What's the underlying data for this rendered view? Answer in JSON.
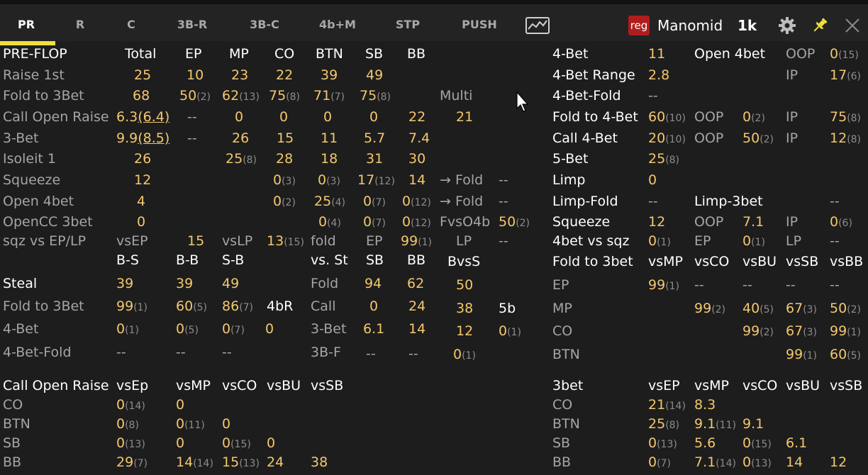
{
  "tabs": [
    "PR",
    "R",
    "C",
    "3B-R",
    "3B-C",
    "4b+M",
    "STP",
    "PUSH"
  ],
  "active_tab": "PR",
  "colors": {
    "accent": "#f2df3c",
    "value": "#f3c76e",
    "badge": "#b01d1d"
  },
  "icons": [
    "chart-icon",
    "gear-icon",
    "pin-icon",
    "close-icon"
  ],
  "player": {
    "badge": "reg",
    "name": "Manomid",
    "hands": "1k"
  },
  "cells": [
    [
      "PRE-FLOP",
      "h"
    ],
    [
      "Total",
      "h"
    ],
    [
      "EP",
      "h"
    ],
    [
      "MP",
      "h"
    ],
    [
      "CO",
      "h"
    ],
    [
      "BTN",
      "h"
    ],
    [
      "SB",
      "h"
    ],
    [
      "BB",
      "h"
    ],
    [
      "Raise 1st",
      "l"
    ],
    [
      "25",
      "v"
    ],
    [
      "10",
      "v"
    ],
    [
      "23",
      "v"
    ],
    [
      "22",
      "v"
    ],
    [
      "39",
      "v"
    ],
    [
      "49",
      "v"
    ],
    [
      "Fold to 3Bet",
      "l"
    ],
    [
      "68",
      "v"
    ],
    [
      "50",
      "v",
      "(2)"
    ],
    [
      "62",
      "v",
      "(13)"
    ],
    [
      "75",
      "v",
      "(8)"
    ],
    [
      "71",
      "v",
      "(7)"
    ],
    [
      "75",
      "v",
      "(8)"
    ],
    [
      "Multi",
      "l"
    ],
    [
      "Call Open Raise",
      "l"
    ],
    [
      "6.3",
      "v",
      "",
      "(6.4)"
    ],
    [
      "--",
      "g"
    ],
    [
      "0",
      "v"
    ],
    [
      "0",
      "v"
    ],
    [
      "0",
      "v"
    ],
    [
      "0",
      "v"
    ],
    [
      "22",
      "v"
    ],
    [
      "21",
      "v"
    ],
    [
      "3-Bet",
      "l"
    ],
    [
      "9.9",
      "v",
      "",
      "(8.5)"
    ],
    [
      "--",
      "g"
    ],
    [
      "26",
      "v"
    ],
    [
      "15",
      "v"
    ],
    [
      "11",
      "v"
    ],
    [
      "5.7",
      "v"
    ],
    [
      "7.4",
      "v"
    ],
    [
      "Isoleit 1",
      "l"
    ],
    [
      "26",
      "v"
    ],
    [
      "25",
      "v",
      "(8)"
    ],
    [
      "28",
      "v"
    ],
    [
      "18",
      "v"
    ],
    [
      "31",
      "v"
    ],
    [
      "30",
      "v"
    ],
    [
      "Squeeze",
      "l"
    ],
    [
      "12",
      "v"
    ],
    [
      "0",
      "v",
      "(3)"
    ],
    [
      "0",
      "v",
      "(3)"
    ],
    [
      "17",
      "v",
      "(12)"
    ],
    [
      "14",
      "v"
    ],
    [
      "→ Fold",
      "l"
    ],
    [
      "--",
      "g"
    ],
    [
      "Open 4bet",
      "l"
    ],
    [
      "4",
      "v"
    ],
    [
      "0",
      "v",
      "(2)"
    ],
    [
      "25",
      "v",
      "(4)"
    ],
    [
      "0",
      "v",
      "(7)"
    ],
    [
      "0",
      "v",
      "(12)"
    ],
    [
      "→ Fold",
      "l"
    ],
    [
      "--",
      "g"
    ],
    [
      "OpenCC 3bet",
      "l"
    ],
    [
      "0",
      "v"
    ],
    [
      "0",
      "v",
      "(4)"
    ],
    [
      "0",
      "v",
      "(7)"
    ],
    [
      "0",
      "v",
      "(12)"
    ],
    [
      "FvsO4b",
      "l"
    ],
    [
      "50",
      "v",
      "(2)"
    ],
    [
      "sqz vs EP/LP",
      "l"
    ],
    [
      "vsEP",
      "l"
    ],
    [
      "15",
      "v"
    ],
    [
      "vsLP",
      "l"
    ],
    [
      "13",
      "v",
      "(15)"
    ],
    [
      "fold",
      "l"
    ],
    [
      "EP",
      "l"
    ],
    [
      "99",
      "v",
      "(1)"
    ],
    [
      "LP",
      "l"
    ],
    [
      "--",
      "g"
    ],
    [
      "B-S",
      "h"
    ],
    [
      "B-B",
      "h"
    ],
    [
      "S-B",
      "h"
    ],
    [
      "vs. St",
      "h"
    ],
    [
      "SB",
      "h"
    ],
    [
      "BB",
      "h"
    ],
    [
      "BvsS",
      "h"
    ],
    [
      "Steal",
      "h"
    ],
    [
      "39",
      "v"
    ],
    [
      "39",
      "v"
    ],
    [
      "49",
      "v"
    ],
    [
      "Fold",
      "l"
    ],
    [
      "94",
      "v"
    ],
    [
      "62",
      "v"
    ],
    [
      "50",
      "v"
    ],
    [
      "Fold to 3Bet",
      "l"
    ],
    [
      "99",
      "v",
      "(1)"
    ],
    [
      "60",
      "v",
      "(5)"
    ],
    [
      "86",
      "v",
      "(7)"
    ],
    [
      "4bR",
      "h"
    ],
    [
      "Call",
      "l"
    ],
    [
      "0",
      "v"
    ],
    [
      "24",
      "v"
    ],
    [
      "38",
      "v"
    ],
    [
      "5b",
      "h"
    ],
    [
      "4-Bet",
      "l"
    ],
    [
      "0",
      "v",
      "(1)"
    ],
    [
      "0",
      "v",
      "(5)"
    ],
    [
      "0",
      "v",
      "(7)"
    ],
    [
      "0",
      "v"
    ],
    [
      "3-Bet",
      "l"
    ],
    [
      "6.1",
      "v"
    ],
    [
      "14",
      "v"
    ],
    [
      "12",
      "v"
    ],
    [
      "0",
      "v",
      "(1)"
    ],
    [
      "4-Bet-Fold",
      "l"
    ],
    [
      "--",
      "g"
    ],
    [
      "--",
      "g"
    ],
    [
      "--",
      "g"
    ],
    [
      "3B-F",
      "l"
    ],
    [
      "--",
      "g"
    ],
    [
      "--",
      "g"
    ],
    [
      "0",
      "v",
      "(1)"
    ],
    [
      "Call Open Raise",
      "h"
    ],
    [
      "vsEp",
      "h"
    ],
    [
      "vsMP",
      "h"
    ],
    [
      "vsCO",
      "h"
    ],
    [
      "vsBU",
      "h"
    ],
    [
      "vsSB",
      "h"
    ],
    [
      "CO",
      "l"
    ],
    [
      "0",
      "v",
      "(14)"
    ],
    [
      "0",
      "v"
    ],
    [
      "BTN",
      "l"
    ],
    [
      "0",
      "v",
      "(8)"
    ],
    [
      "0",
      "v",
      "(11)"
    ],
    [
      "0",
      "v"
    ],
    [
      "SB",
      "l"
    ],
    [
      "0",
      "v",
      "(13)"
    ],
    [
      "0",
      "v"
    ],
    [
      "0",
      "v",
      "(15)"
    ],
    [
      "0",
      "v"
    ],
    [
      "BB",
      "l"
    ],
    [
      "29",
      "v",
      "(7)"
    ],
    [
      "14",
      "v",
      "(14)"
    ],
    [
      "15",
      "v",
      "(13)"
    ],
    [
      "24",
      "v"
    ],
    [
      "38",
      "v"
    ],
    [
      "4-Bet",
      "h"
    ],
    [
      "11",
      "v"
    ],
    [
      "Open 4bet",
      "h"
    ],
    [
      "OOP",
      "l"
    ],
    [
      "0",
      "v",
      "(15)"
    ],
    [
      "4-Bet Range",
      "h"
    ],
    [
      "2.8",
      "v"
    ],
    [
      "IP",
      "l"
    ],
    [
      "17",
      "v",
      "(6)"
    ],
    [
      "4-Bet-Fold",
      "h"
    ],
    [
      "--",
      "g"
    ],
    [
      "Fold to 4-Bet",
      "h"
    ],
    [
      "60",
      "v",
      "(10)"
    ],
    [
      "OOP",
      "l"
    ],
    [
      "0",
      "v",
      "(2)"
    ],
    [
      "IP",
      "l"
    ],
    [
      "75",
      "v",
      "(8)"
    ],
    [
      "Call 4-Bet",
      "h"
    ],
    [
      "20",
      "v",
      "(10)"
    ],
    [
      "OOP",
      "l"
    ],
    [
      "50",
      "v",
      "(2)"
    ],
    [
      "IP",
      "l"
    ],
    [
      "12",
      "v",
      "(8)"
    ],
    [
      "5-Bet",
      "h"
    ],
    [
      "25",
      "v",
      "(8)"
    ],
    [
      "Limp",
      "h"
    ],
    [
      "0",
      "v"
    ],
    [
      "Limp-Fold",
      "h"
    ],
    [
      "--",
      "g"
    ],
    [
      "Limp-3bet",
      "h"
    ],
    [
      "--",
      "g"
    ],
    [
      "Squeeze",
      "h"
    ],
    [
      "12",
      "v"
    ],
    [
      "OOP",
      "l"
    ],
    [
      "7.1",
      "v"
    ],
    [
      "IP",
      "l"
    ],
    [
      "0",
      "v",
      "(6)"
    ],
    [
      "4bet vs sqz",
      "h"
    ],
    [
      "0",
      "v",
      "(1)"
    ],
    [
      "EP",
      "l"
    ],
    [
      "0",
      "v",
      "(1)"
    ],
    [
      "LP",
      "l"
    ],
    [
      "--",
      "g"
    ],
    [
      "Fold to 3bet",
      "h"
    ],
    [
      "vsMP",
      "h"
    ],
    [
      "vsCO",
      "h"
    ],
    [
      "vsBU",
      "h"
    ],
    [
      "vsSB",
      "h"
    ],
    [
      "vsBB",
      "h"
    ],
    [
      "EP",
      "l"
    ],
    [
      "99",
      "v",
      "(1)"
    ],
    [
      "--",
      "g"
    ],
    [
      "--",
      "g"
    ],
    [
      "--",
      "g"
    ],
    [
      "--",
      "g"
    ],
    [
      "MP",
      "l"
    ],
    [
      "99",
      "v",
      "(2)"
    ],
    [
      "40",
      "v",
      "(5)"
    ],
    [
      "67",
      "v",
      "(3)"
    ],
    [
      "50",
      "v",
      "(2)"
    ],
    [
      "CO",
      "l"
    ],
    [
      "99",
      "v",
      "(2)"
    ],
    [
      "67",
      "v",
      "(3)"
    ],
    [
      "99",
      "v",
      "(1)"
    ],
    [
      "BTN",
      "l"
    ],
    [
      "99",
      "v",
      "(1)"
    ],
    [
      "60",
      "v",
      "(5)"
    ],
    [
      "3bet",
      "h"
    ],
    [
      "vsEP",
      "h"
    ],
    [
      "vsMP",
      "h"
    ],
    [
      "vsCO",
      "h"
    ],
    [
      "vsBU",
      "h"
    ],
    [
      "vsSB",
      "h"
    ],
    [
      "CO",
      "l"
    ],
    [
      "21",
      "v",
      "(14)"
    ],
    [
      "8.3",
      "v"
    ],
    [
      "BTN",
      "l"
    ],
    [
      "25",
      "v",
      "(8)"
    ],
    [
      "9.1",
      "v",
      "(11)"
    ],
    [
      "9.1",
      "v"
    ],
    [
      "SB",
      "l"
    ],
    [
      "0",
      "v",
      "(13)"
    ],
    [
      "5.6",
      "v"
    ],
    [
      "0",
      "v",
      "(15)"
    ],
    [
      "6.1",
      "v"
    ],
    [
      "BB",
      "l"
    ],
    [
      "0",
      "v",
      "(7)"
    ],
    [
      "7.1",
      "v",
      "(14)"
    ],
    [
      "0",
      "v",
      "(13)"
    ],
    [
      "14",
      "v"
    ],
    [
      "12",
      "v"
    ]
  ]
}
